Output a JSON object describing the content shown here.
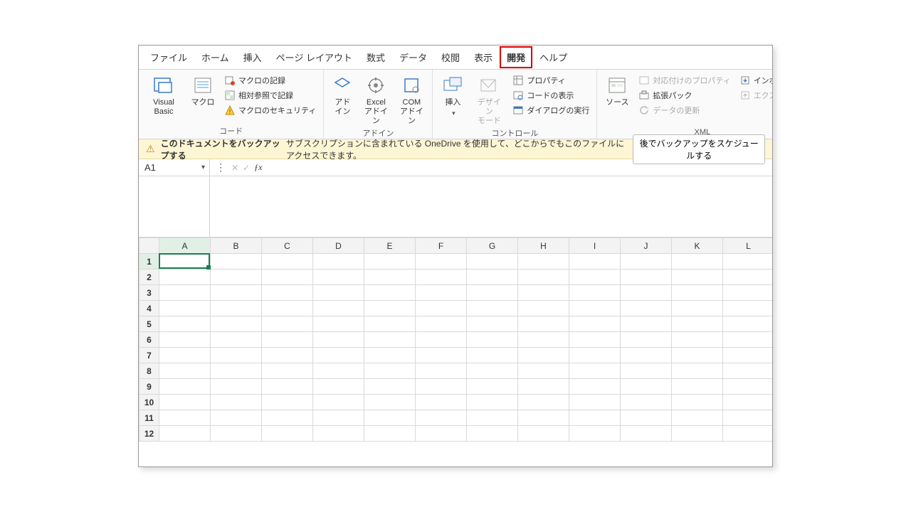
{
  "tabs": {
    "file": "ファイル",
    "home": "ホーム",
    "insert": "挿入",
    "layout": "ページ レイアウト",
    "formulas": "数式",
    "data": "データ",
    "review": "校閲",
    "view": "表示",
    "developer": "開発",
    "help": "ヘルプ"
  },
  "ribbon": {
    "code_group": "コード",
    "vbasic": "Visual Basic",
    "macros": "マクロ",
    "record_macro": "マクロの記録",
    "relative_ref": "相対参照で記録",
    "macro_security": "マクロのセキュリティ",
    "addins_group": "アドイン",
    "addins": "アド\nイン",
    "excel_addins": "Excel\nアドイン",
    "com_addins": "COM\nアドイン",
    "controls_group": "コントロール",
    "insert": "挿入",
    "design_mode": "デザイン\nモード",
    "properties": "プロパティ",
    "view_code": "コードの表示",
    "run_dialog": "ダイアログの実行",
    "xml_group": "XML",
    "source": "ソース",
    "map_props": "対応付けのプロパティ",
    "expansion": "拡張パック",
    "refresh": "データの更新",
    "import": "インポート",
    "export": "エクスポート"
  },
  "messagebar": {
    "title": "このドキュメントをバックアップする",
    "body": "サブスクリプションに含まれている OneDrive を使用して、どこからでもこのファイルにアクセスできます。",
    "button": "後でバックアップをスケジュールする"
  },
  "formulabar": {
    "cellref": "A1",
    "formula": ""
  },
  "grid": {
    "columns": [
      "A",
      "B",
      "C",
      "D",
      "E",
      "F",
      "G",
      "H",
      "I",
      "J",
      "K",
      "L"
    ],
    "rows": [
      "1",
      "2",
      "3",
      "4",
      "5",
      "6",
      "7",
      "8",
      "9",
      "10",
      "11",
      "12"
    ],
    "selected": {
      "col": "A",
      "row": "1"
    }
  }
}
